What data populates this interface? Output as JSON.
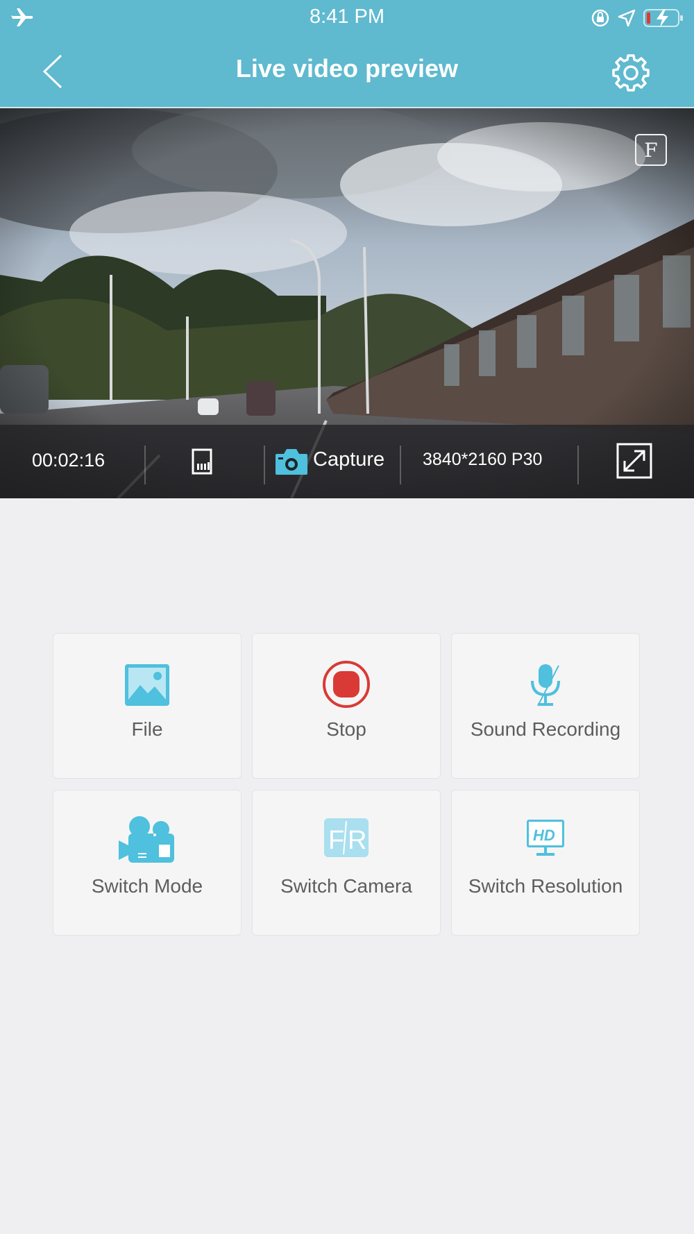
{
  "status_bar": {
    "time": "8:41 PM"
  },
  "navbar": {
    "title": "Live video preview"
  },
  "video": {
    "badge": "F",
    "elapsed": "00:02:16",
    "capture_label": "Capture",
    "resolution": "3840*2160 P30"
  },
  "actions": [
    {
      "label": "File"
    },
    {
      "label": "Stop"
    },
    {
      "label": "Sound Recording"
    },
    {
      "label": "Switch Mode"
    },
    {
      "label": "Switch Camera"
    },
    {
      "label": "Switch Resolution"
    }
  ],
  "colors": {
    "header": "#5fb9cf",
    "accent": "#4fc0dd",
    "stop": "#d93a35",
    "background": "#efeef0"
  }
}
